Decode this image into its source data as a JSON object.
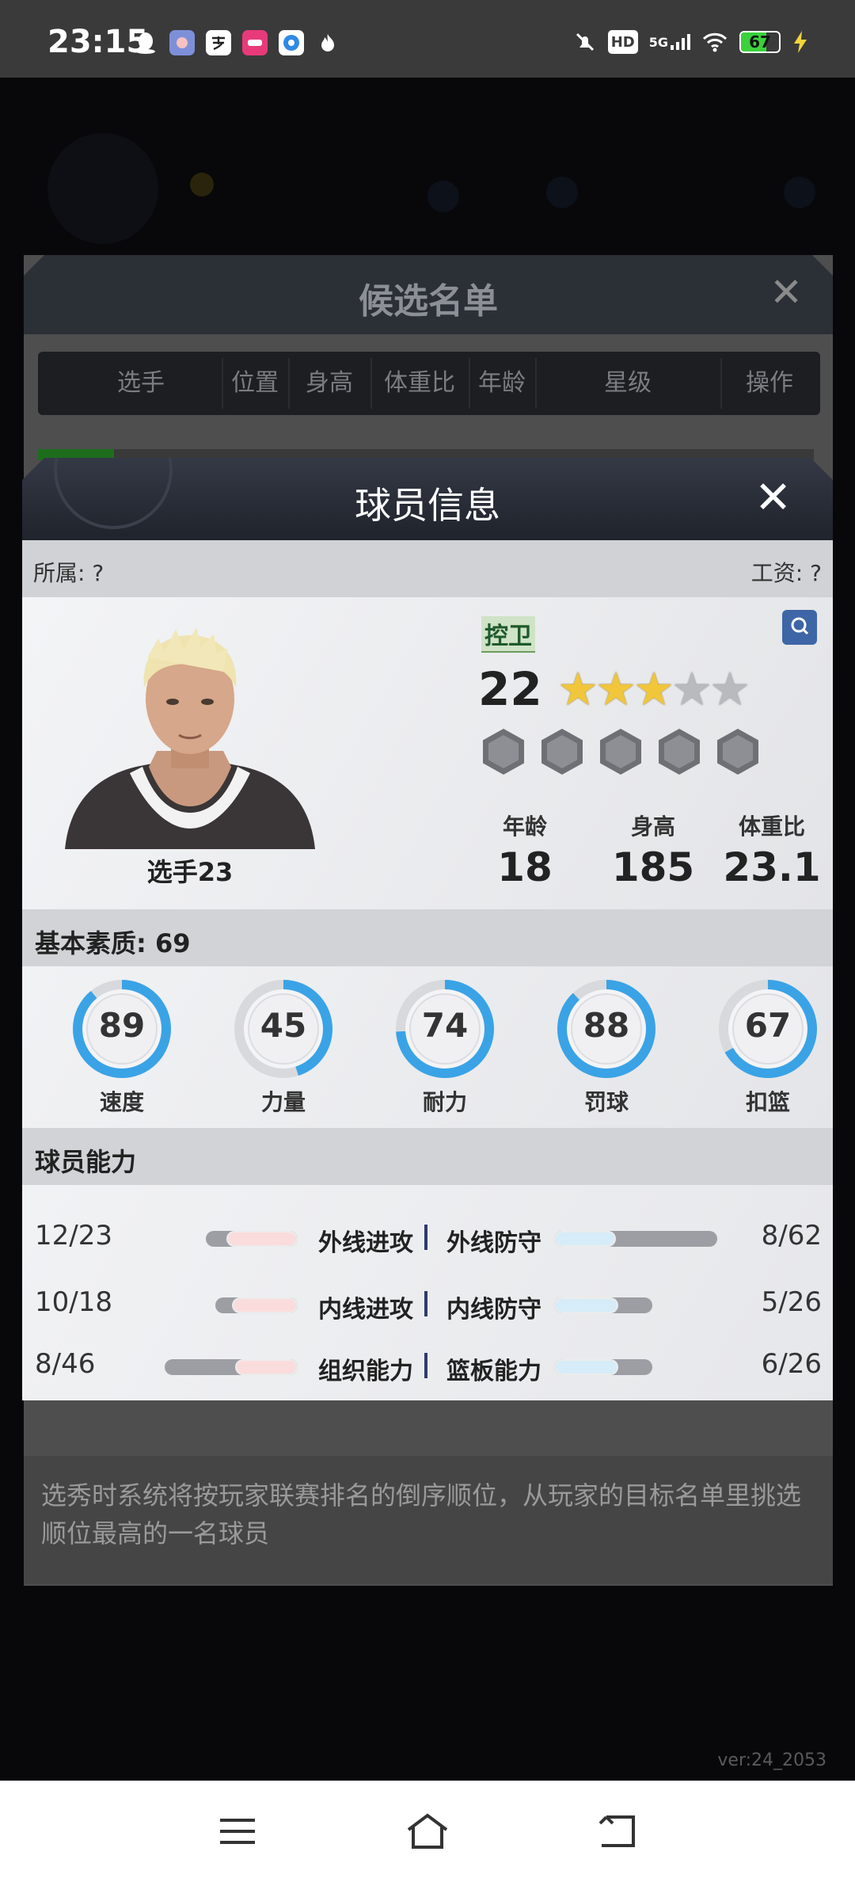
{
  "status_bar": {
    "time": "23:15",
    "notification_icons": [
      "qq-icon",
      "app-icon",
      "alipay-icon",
      "lofter-icon",
      "baidu-netdisk-icon",
      "flame-icon"
    ],
    "system_icons": [
      "mute-icon",
      "hd-icon",
      "signal-5g-icon",
      "wifi-icon"
    ],
    "network_label": "5G",
    "hd_label": "HD",
    "battery": {
      "level": 67,
      "label": "67",
      "charging": true
    }
  },
  "background": {
    "candidate_title": "候选名单",
    "columns": [
      "选手",
      "位置",
      "身高",
      "体重比",
      "年龄",
      "星级",
      "操作"
    ],
    "draft_note": "选秀时系统将按玩家联赛排名的倒序顺位，从玩家的目标名单里挑选顺位最高的一名球员",
    "version": "ver:24_2053"
  },
  "modal": {
    "title": "球员信息",
    "affiliation": "所属: ?",
    "salary": "工资: ?",
    "player_name": "选手23",
    "position": "控卫",
    "rating": "22",
    "stars": {
      "total": 5,
      "filled": 3
    },
    "hex_badges": 5,
    "attributes": [
      {
        "label": "年龄",
        "value": "18"
      },
      {
        "label": "身高",
        "value": "185"
      },
      {
        "label": "体重比",
        "value": "23.1"
      }
    ],
    "basic_quality": "基本素质: 69",
    "gauges": [
      {
        "label": "速度",
        "value": 89
      },
      {
        "label": "力量",
        "value": 45
      },
      {
        "label": "耐力",
        "value": 74
      },
      {
        "label": "罚球",
        "value": 88
      },
      {
        "label": "扣篮",
        "value": 67
      }
    ],
    "ability_title": "球员能力",
    "abilities": [
      {
        "left_value": "12/23",
        "left_label": "外线进攻",
        "left_fill": 0.78,
        "right_label": "外线防守",
        "right_value": "8/62",
        "right_fill": 0.38
      },
      {
        "left_value": "10/18",
        "left_label": "内线进攻",
        "left_fill": 0.8,
        "right_label": "内线防守",
        "right_value": "5/26",
        "right_fill": 0.65
      },
      {
        "left_value": "8/46",
        "left_label": "组织能力",
        "left_fill": 0.47,
        "right_label": "篮板能力",
        "right_value": "6/26",
        "right_fill": 0.65
      }
    ]
  },
  "colors": {
    "gauge_accent": "#3aa3e6",
    "gauge_track": "#d8d9dc",
    "star_on": "#f2c63a",
    "position_tag": "#1f5a2a"
  },
  "nav": [
    "menu-icon",
    "home-icon",
    "back-icon"
  ]
}
